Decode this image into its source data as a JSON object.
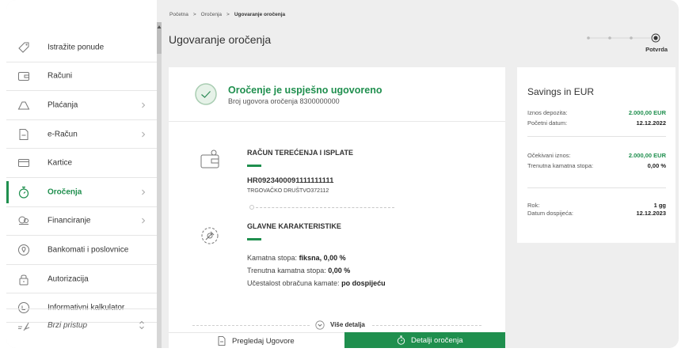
{
  "breadcrumb": {
    "home": "Početna",
    "section": "Oročenja",
    "current": "Ugovaranje oročenja",
    "separator": ">"
  },
  "page": {
    "title": "Ugovaranje oročenja"
  },
  "stepper": {
    "label": "Potvrda",
    "steps_total": 4,
    "current_step": 4
  },
  "sidebar": {
    "items": [
      {
        "label": "Istražite ponude",
        "icon": "tag-icon",
        "chevron": false
      },
      {
        "label": "Računi",
        "icon": "wallet-icon",
        "chevron": false
      },
      {
        "label": "Plaćanja",
        "icon": "triangle-icon",
        "chevron": true
      },
      {
        "label": "e-Račun",
        "icon": "document-icon",
        "chevron": true
      },
      {
        "label": "Kartice",
        "icon": "card-icon",
        "chevron": false
      },
      {
        "label": "Oročenja",
        "icon": "timer-icon",
        "chevron": true,
        "active": true
      },
      {
        "label": "Financiranje",
        "icon": "coins-icon",
        "chevron": true
      },
      {
        "label": "Bankomati i poslovnice",
        "icon": "location-pin-icon",
        "chevron": false
      },
      {
        "label": "Autorizacija",
        "icon": "lock-icon",
        "chevron": false
      },
      {
        "label": "Informativni kalkulator",
        "icon": "calculator-icon",
        "chevron": false
      }
    ],
    "quick_access": "Brzi pristup"
  },
  "success": {
    "title": "Oročenje je uspješno ugovoreno",
    "subtitle": "Broj ugovora oročenja 8300000000"
  },
  "account": {
    "heading": "RAČUN TEREĆENJA I ISPLATE",
    "iban": "HR0923400091111111111",
    "company": "TRGOVAČKO DRUŠTVO372112"
  },
  "features": {
    "heading": "GLAVNE KARAKTERISTIKE",
    "rate_label": "Kamatna stopa:",
    "rate_value": "fiksna, 0,00 %",
    "current_rate_label": "Trenutna kamatna stopa:",
    "current_rate_value": "0,00 %",
    "frequency_label": "Učestalost obračuna kamate:",
    "frequency_value": "po dospijeću"
  },
  "more_details": "Više detalja",
  "buttons": {
    "review": "Pregledaj Ugovore",
    "details": "Detalji oročenja"
  },
  "summary": {
    "title": "Savings in EUR",
    "deposit_label": "Iznos depozita:",
    "deposit_value": "2.000,00 EUR",
    "start_label": "Početni datum:",
    "start_value": "12.12.2022",
    "expected_label": "Očekivani iznos:",
    "expected_value": "2.000,00 EUR",
    "current_rate_label": "Trenutna kamatna stopa:",
    "current_rate_value": "0,00 %",
    "term_label": "Rok:",
    "term_value": "1 gg",
    "maturity_label": "Datum dospijeća:",
    "maturity_value": "12.12.2023"
  },
  "colors": {
    "accent": "#1f8f4e",
    "background": "#eeeeee"
  }
}
